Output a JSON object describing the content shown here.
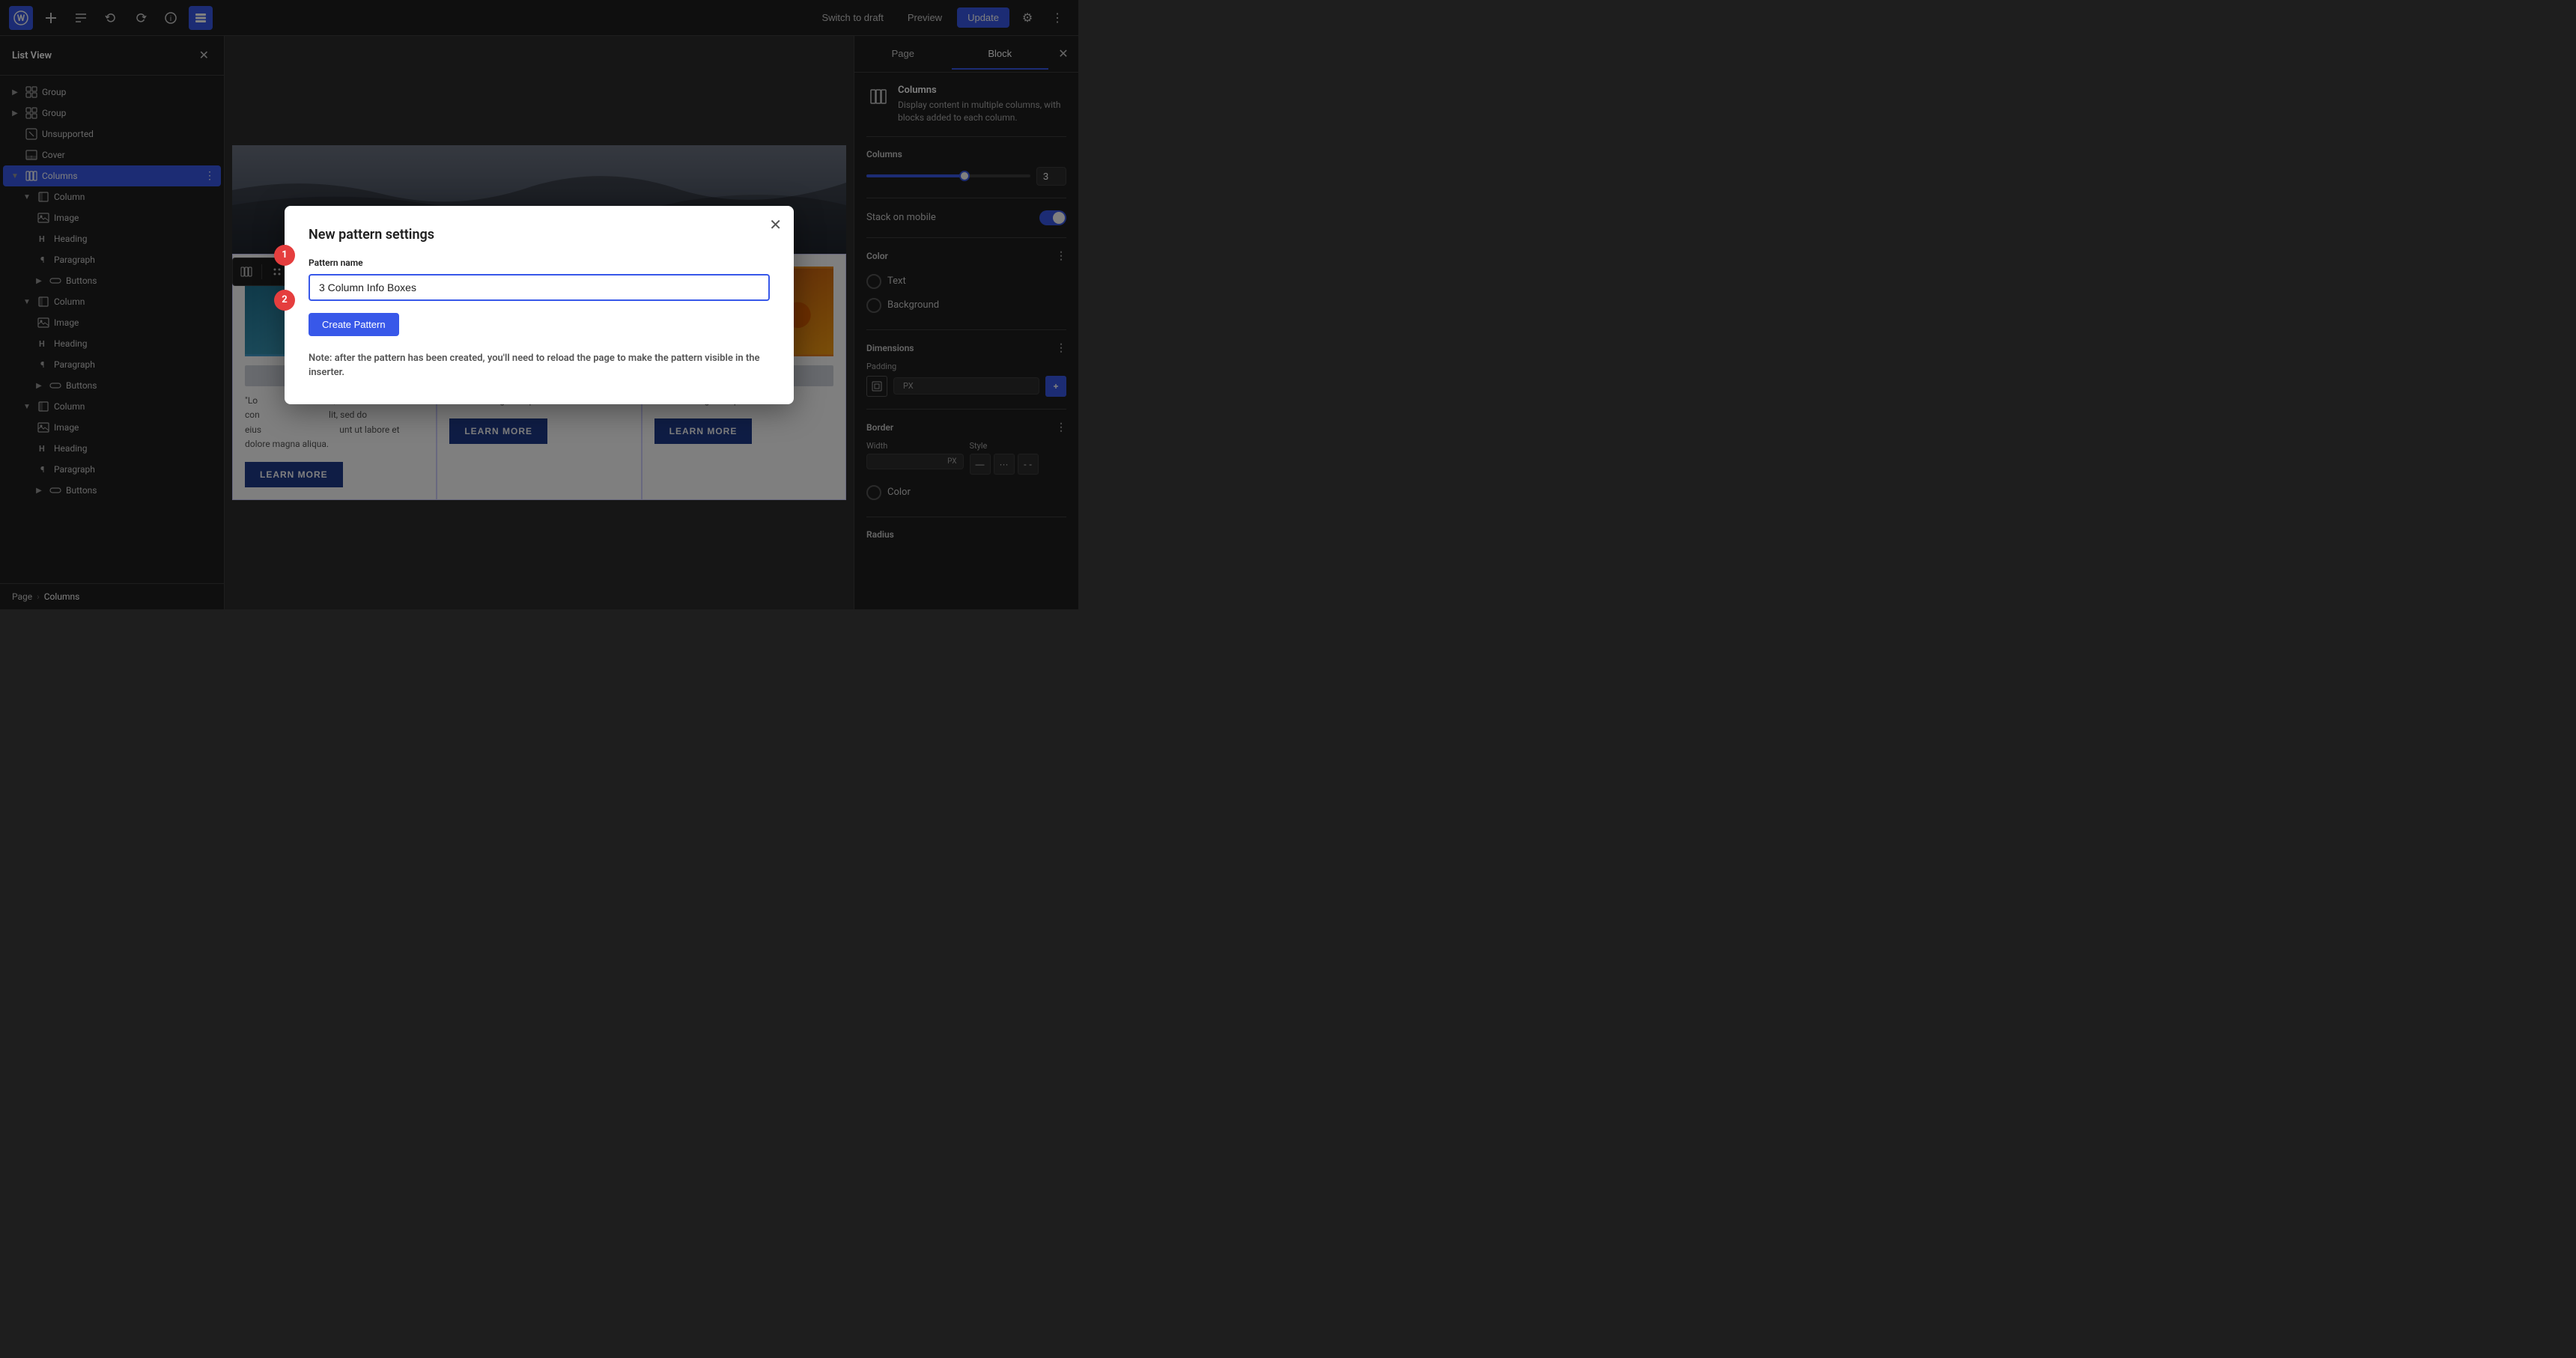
{
  "topbar": {
    "wp_logo": "W",
    "switch_to_draft": "Switch to draft",
    "preview": "Preview",
    "update": "Update"
  },
  "sidebar_left": {
    "title": "List View",
    "items": [
      {
        "id": "group1",
        "label": "Group",
        "level": 0,
        "expanded": false,
        "icon": "group"
      },
      {
        "id": "group2",
        "label": "Group",
        "level": 0,
        "expanded": false,
        "icon": "group"
      },
      {
        "id": "unsupported",
        "label": "Unsupported",
        "level": 0,
        "expanded": false,
        "icon": "unsupported"
      },
      {
        "id": "cover",
        "label": "Cover",
        "level": 0,
        "expanded": false,
        "icon": "cover"
      },
      {
        "id": "columns",
        "label": "Columns",
        "level": 0,
        "expanded": true,
        "icon": "columns",
        "active": true
      },
      {
        "id": "column1",
        "label": "Column",
        "level": 1,
        "expanded": true,
        "icon": "column"
      },
      {
        "id": "image1",
        "label": "Image",
        "level": 2,
        "icon": "image"
      },
      {
        "id": "heading1",
        "label": "Heading",
        "level": 2,
        "icon": "heading"
      },
      {
        "id": "paragraph1",
        "label": "Paragraph",
        "level": 2,
        "icon": "paragraph"
      },
      {
        "id": "buttons1",
        "label": "Buttons",
        "level": 2,
        "expanded": false,
        "icon": "buttons"
      },
      {
        "id": "column2",
        "label": "Column",
        "level": 1,
        "expanded": true,
        "icon": "column"
      },
      {
        "id": "image2",
        "label": "Image",
        "level": 2,
        "icon": "image"
      },
      {
        "id": "heading2",
        "label": "Heading",
        "level": 2,
        "icon": "heading"
      },
      {
        "id": "paragraph2",
        "label": "Paragraph",
        "level": 2,
        "icon": "paragraph"
      },
      {
        "id": "buttons2",
        "label": "Buttons",
        "level": 2,
        "expanded": false,
        "icon": "buttons"
      },
      {
        "id": "column3",
        "label": "Column",
        "level": 1,
        "expanded": true,
        "icon": "column"
      },
      {
        "id": "image3",
        "label": "Image",
        "level": 2,
        "icon": "image"
      },
      {
        "id": "heading3",
        "label": "Heading",
        "level": 2,
        "icon": "heading"
      },
      {
        "id": "paragraph3",
        "label": "Paragraph",
        "level": 2,
        "icon": "paragraph"
      },
      {
        "id": "buttons3",
        "label": "Buttons",
        "level": 2,
        "expanded": false,
        "icon": "buttons"
      }
    ],
    "breadcrumb": {
      "page": "Page",
      "current": "Columns"
    }
  },
  "sidebar_right": {
    "tabs": [
      "Page",
      "Block"
    ],
    "active_tab": "Block",
    "block_name": "Columns",
    "block_desc": "Display content in multiple columns, with blocks added to each column.",
    "columns_label": "Columns",
    "columns_value": "3",
    "stack_on_mobile_label": "Stack on mobile",
    "color_label": "Color",
    "text_label": "Text",
    "background_label": "Background",
    "dimensions_label": "Dimensions",
    "padding_label": "Padding",
    "px_unit": "PX",
    "border_label": "Border",
    "width_label": "Width",
    "style_label": "Style",
    "color_option_label": "Color",
    "radius_label": "Radius"
  },
  "modal": {
    "title": "New pattern settings",
    "pattern_name_label": "Pattern name",
    "pattern_name_value": "3 Column Info Boxes",
    "create_btn": "Create Pattern",
    "note": "Note: after the pattern has been created, you'll need to reload the page to make the pattern visible in the inserter.",
    "step1": "1",
    "step2": "2"
  },
  "canvas": {
    "columns": [
      {
        "paragraph": "\"Lo                                                   amet, con                                                     lit, sed do eius                                                   unt ut labore et dolore magna aliqua.",
        "btn_label": "LEARN MORE"
      },
      {
        "paragraph": "et dolore magna aliqua.",
        "btn_label": "LEARN MORE"
      },
      {
        "paragraph": "et dolore magna aliqua.",
        "btn_label": "LEARN MORE"
      }
    ]
  }
}
